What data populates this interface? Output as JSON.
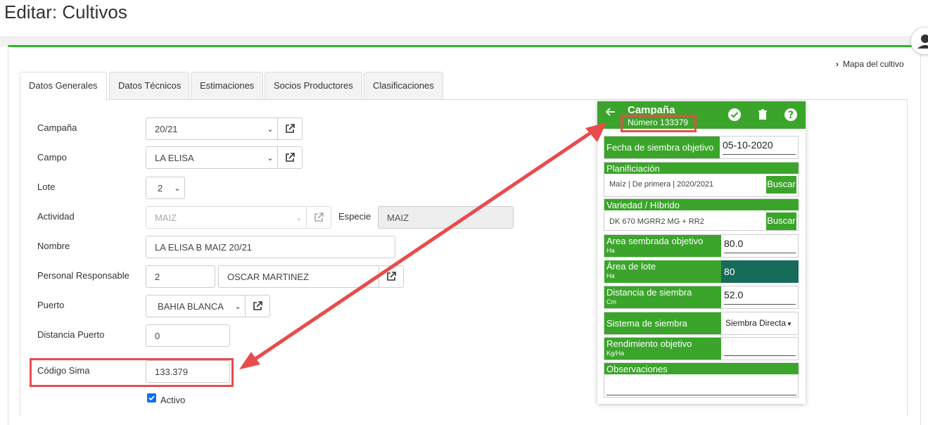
{
  "page": {
    "title": "Editar: Cultivos"
  },
  "map_link": {
    "label": "Mapa del cultivo"
  },
  "tabs": [
    {
      "label": "Datos Generales",
      "active": true
    },
    {
      "label": "Datos Técnicos"
    },
    {
      "label": "Estimaciones"
    },
    {
      "label": "Socios Productores"
    },
    {
      "label": "Clasificaciones"
    }
  ],
  "form": {
    "campana": {
      "label": "Campaña",
      "value": "20/21"
    },
    "campo": {
      "label": "Campo",
      "value": "LA ELISA"
    },
    "lote": {
      "label": "Lote",
      "value": "2"
    },
    "actividad": {
      "label": "Actividad",
      "value": "MAIZ",
      "especie_label": "Especie",
      "especie_value": "MAIZ"
    },
    "nombre": {
      "label": "Nombre",
      "value": "LA ELISA B MAIZ 20/21"
    },
    "personal": {
      "label": "Personal Responsable",
      "code": "2",
      "name": "OSCAR MARTINEZ"
    },
    "puerto": {
      "label": "Puerto",
      "value": "BAHIA BLANCA"
    },
    "distancia_puerto": {
      "label": "Distancia Puerto",
      "value": "0"
    },
    "codigo_sima": {
      "label": "Código Sima",
      "value": "133.379"
    },
    "activo": {
      "label": "Activo",
      "checked": true
    }
  },
  "mobile": {
    "title": "Campaña",
    "subtitle": "Número 133379",
    "fecha_label": "Fecha de siembra objetivo",
    "fecha_value": "05-10-2020",
    "planificacion_label": "Planificiación",
    "planificacion_value": "Maíz | De primera | 2020/2021",
    "buscar_label": "Buscar",
    "variedad_label": "Variedad / Híbrido",
    "variedad_value": "DK 670 MGRR2 MG + RR2",
    "area_sembrada_label": "Area sembrada objetivo",
    "area_sembrada_unit": "Ha",
    "area_sembrada_value": "80.0",
    "area_lote_label": "Área de lote",
    "area_lote_unit": "Ha",
    "area_lote_value": "80",
    "distancia_label": "Distancia de siembra",
    "distancia_unit": "Cm",
    "distancia_value": "52.0",
    "sistema_label": "Sistema de siembra",
    "sistema_value": "Siembra Directa",
    "rendimiento_label": "Rendimiento objetivo",
    "rendimiento_unit": "Kg/Ha",
    "rendimiento_value": "",
    "observaciones_label": "Observaciones"
  },
  "colors": {
    "accent_green": "#3aa52a",
    "highlight_red": "#e84c4c",
    "dark_teal": "#176b5a"
  },
  "icons": [
    "external-link-icon",
    "chevron-right-icon",
    "arrow-left-icon",
    "check-circle-icon",
    "trash-icon",
    "help-icon",
    "user-icon",
    "caret-down-icon"
  ]
}
